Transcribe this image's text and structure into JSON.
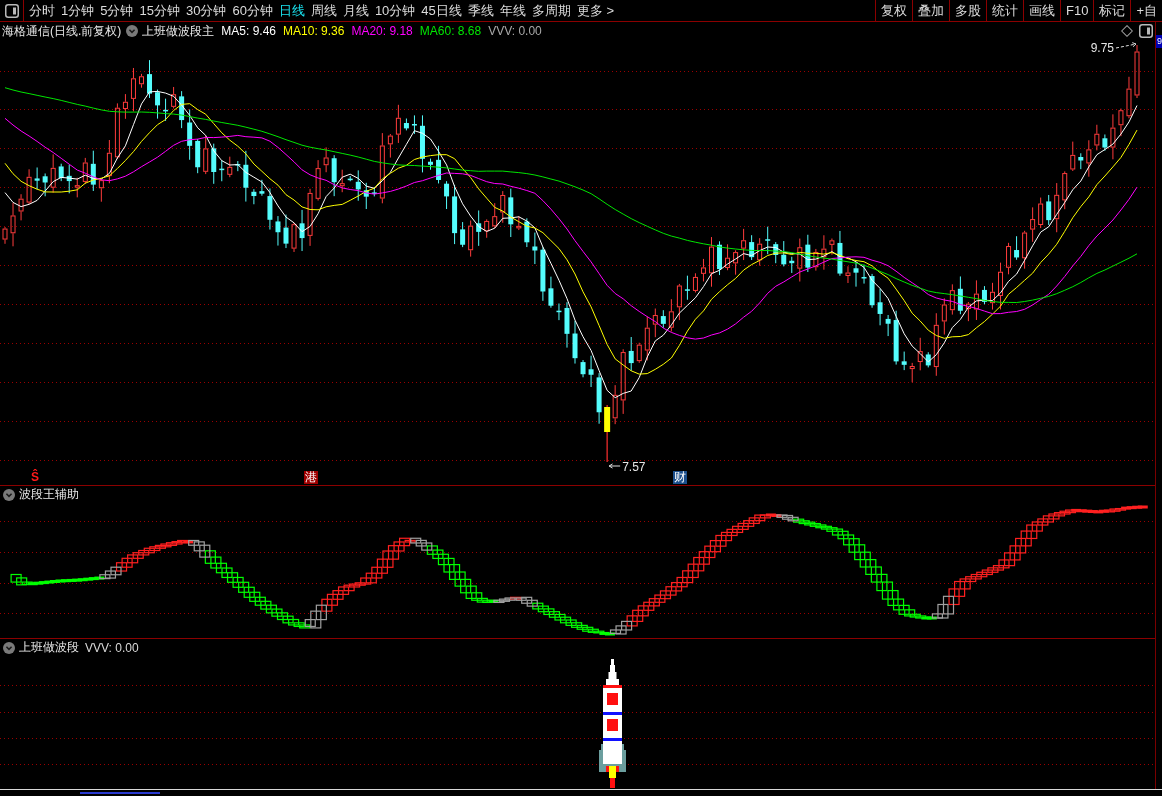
{
  "toolbar": {
    "periods": [
      {
        "label": "分时",
        "selected": false
      },
      {
        "label": "1分钟",
        "selected": false
      },
      {
        "label": "5分钟",
        "selected": false
      },
      {
        "label": "15分钟",
        "selected": false
      },
      {
        "label": "30分钟",
        "selected": false
      },
      {
        "label": "60分钟",
        "selected": false
      },
      {
        "label": "日线",
        "selected": true
      },
      {
        "label": "周线",
        "selected": false
      },
      {
        "label": "月线",
        "selected": false
      },
      {
        "label": "10分钟",
        "selected": false
      },
      {
        "label": "45日线",
        "selected": false
      },
      {
        "label": "季线",
        "selected": false
      },
      {
        "label": "年线",
        "selected": false
      },
      {
        "label": "多周期",
        "selected": false
      },
      {
        "label": "更多 >",
        "selected": false
      }
    ],
    "tools": [
      "复权",
      "叠加",
      "多股",
      "统计",
      "画线",
      "F10",
      "标记",
      "+自"
    ]
  },
  "main_chart": {
    "title": "海格通信(日线.前复权)",
    "indicator": "上班做波段主",
    "legend": [
      {
        "label": "MA5: 9.46",
        "color": "#ffffff"
      },
      {
        "label": "MA10: 9.36",
        "color": "#ffff00"
      },
      {
        "label": "MA20: 9.18",
        "color": "#ff00ff"
      },
      {
        "label": "MA60: 8.68",
        "color": "#00e600"
      },
      {
        "label": "VVV: 0.00",
        "color": "#a8a8a8"
      }
    ],
    "high_label": "9.75",
    "low_label": "7.57",
    "price_axis_label": "9",
    "markers": [
      {
        "kind": "signal",
        "label": "Ŝ",
        "color": "#ff1a1a"
      },
      {
        "kind": "tag",
        "label": "港",
        "color": "#a00000"
      },
      {
        "kind": "tag",
        "label": "财",
        "color": "#1c4f8c"
      }
    ]
  },
  "aux_panel": {
    "title": "波段王辅助"
  },
  "signal_panel": {
    "title": "上班做波段",
    "reading": "VVV: 0.00"
  }
}
